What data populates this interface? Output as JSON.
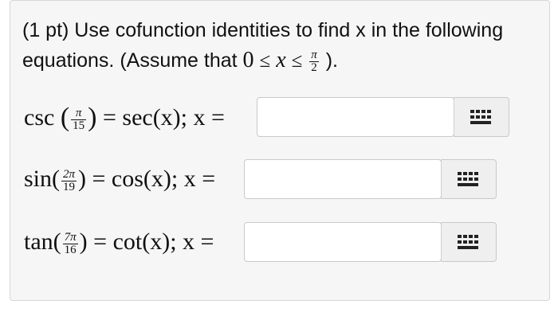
{
  "prompt": {
    "line1": "(1 pt) Use cofunction identities to find x in the following",
    "line2_prefix": "equations. (Assume that",
    "zero": "0",
    "le": "≤",
    "x": "x",
    "pi": "π",
    "two": "2",
    "line2_suffix": " )."
  },
  "equations": [
    {
      "fn": "csc",
      "num": "π",
      "den": "15",
      "rhs": "= sec(x); x =",
      "value": "",
      "icon": "keyboard-icon"
    },
    {
      "fn": "sin(",
      "num": "2π",
      "den": "19",
      "rhs": ") = cos(x); x =",
      "value": "",
      "icon": "keyboard-icon"
    },
    {
      "fn": "tan(",
      "num": "7π",
      "den": "16",
      "rhs": ") = cot(x); x =",
      "value": "",
      "icon": "keyboard-icon"
    }
  ]
}
